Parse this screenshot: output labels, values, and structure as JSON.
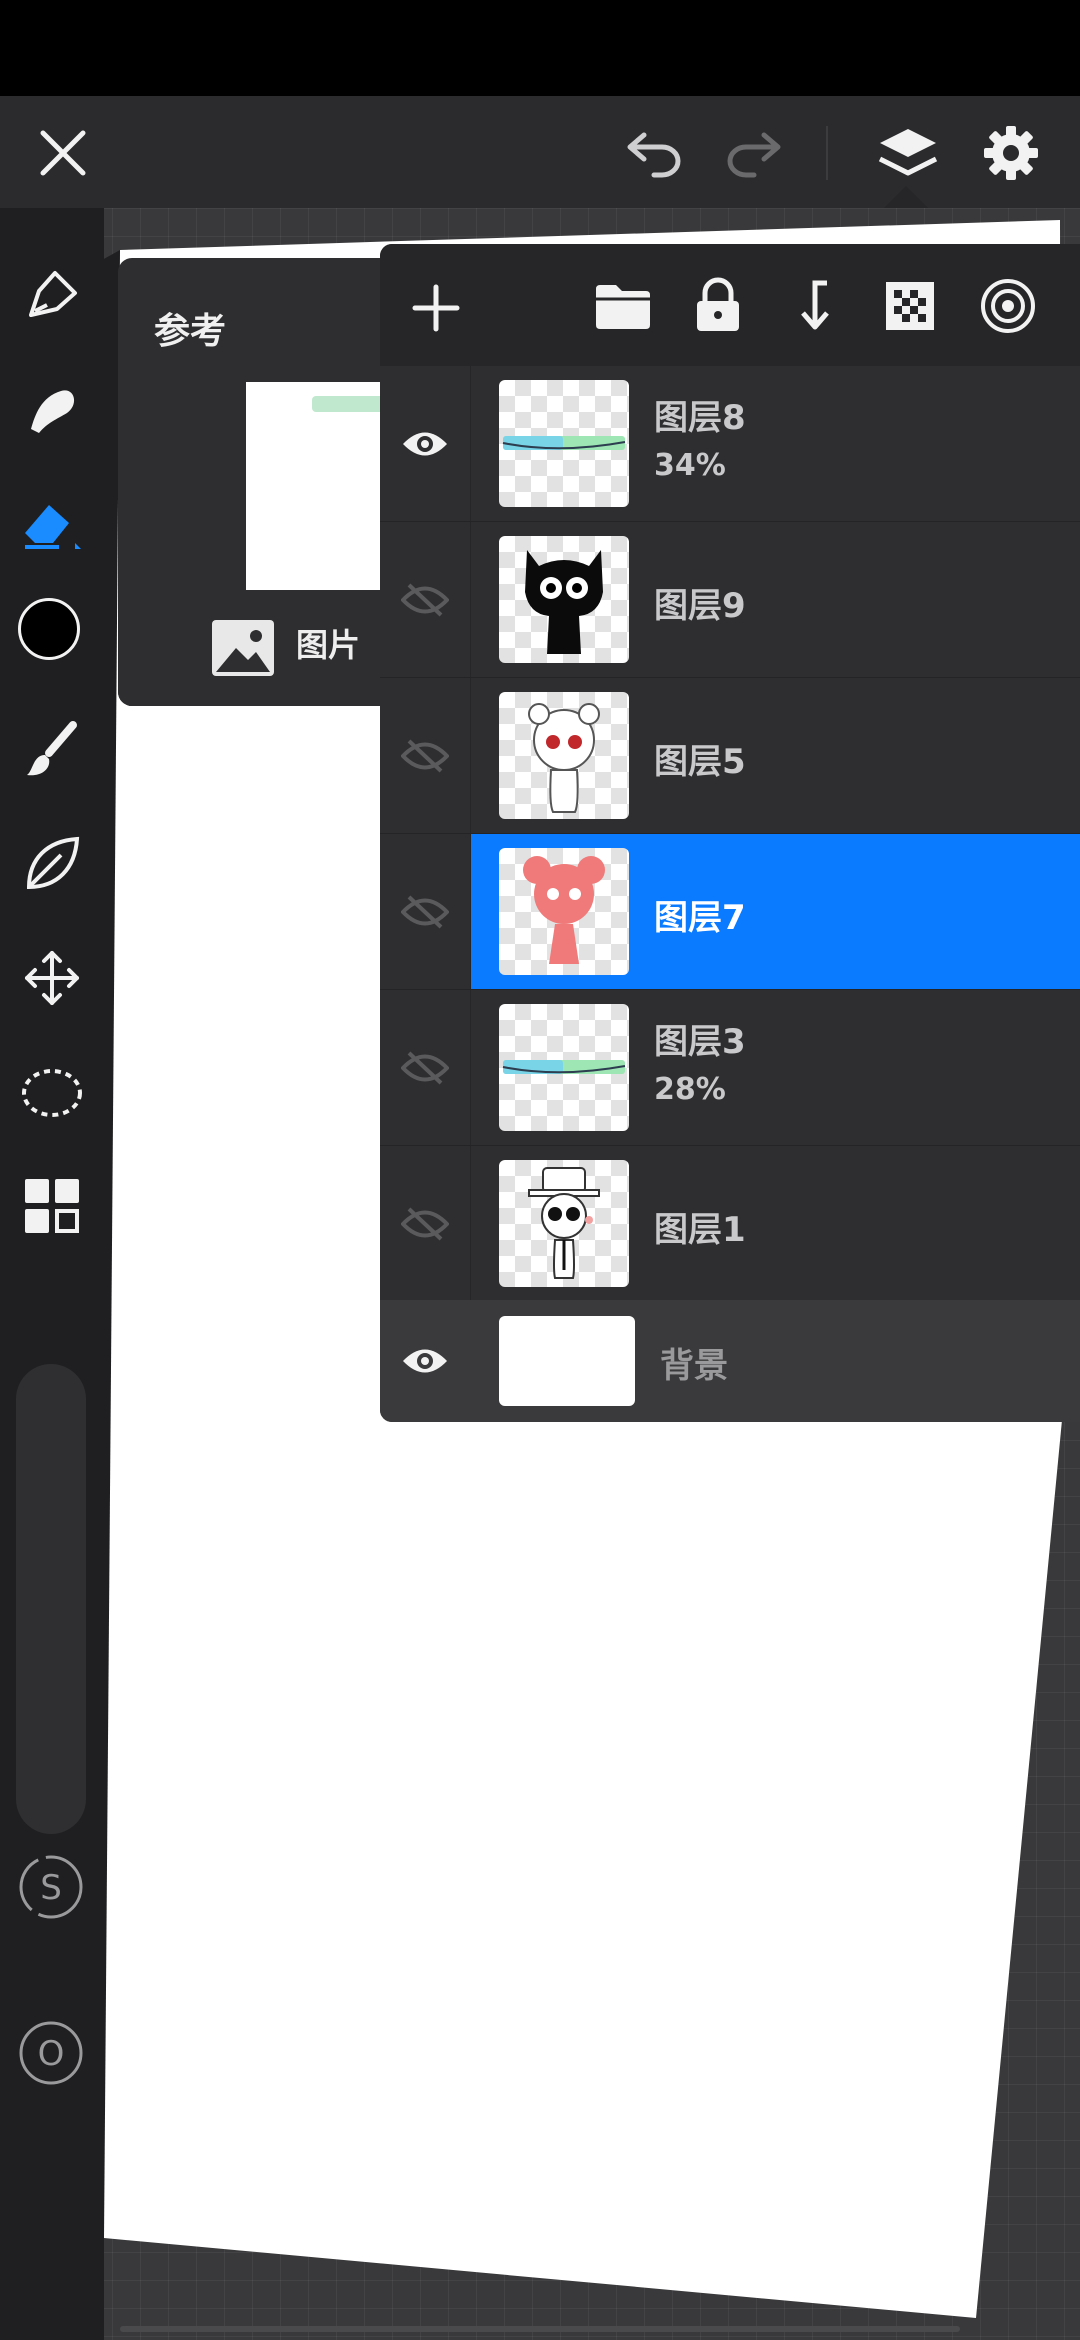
{
  "reference_panel": {
    "tab_label": "参考",
    "image_option_label": "图片"
  },
  "layers": [
    {
      "name": "图层8",
      "opacity": "34%",
      "visible": true,
      "selected": false,
      "thumb": "green-banner"
    },
    {
      "name": "图层9",
      "opacity": "",
      "visible": false,
      "selected": false,
      "thumb": "black-cat-character"
    },
    {
      "name": "图层5",
      "opacity": "",
      "visible": false,
      "selected": false,
      "thumb": "white-character-red-eyes"
    },
    {
      "name": "图层7",
      "opacity": "",
      "visible": false,
      "selected": true,
      "thumb": "red-character"
    },
    {
      "name": "图层3",
      "opacity": "28%",
      "visible": false,
      "selected": false,
      "thumb": "green-banner"
    },
    {
      "name": "图层1",
      "opacity": "",
      "visible": false,
      "selected": false,
      "thumb": "top-hat-character"
    }
  ],
  "background_layer": {
    "name": "背景",
    "visible": true
  },
  "colors": {
    "accent": "#0a7aff",
    "current_color": "#000000"
  },
  "side_sliders": {
    "size_label": "S",
    "opacity_label": "O"
  }
}
